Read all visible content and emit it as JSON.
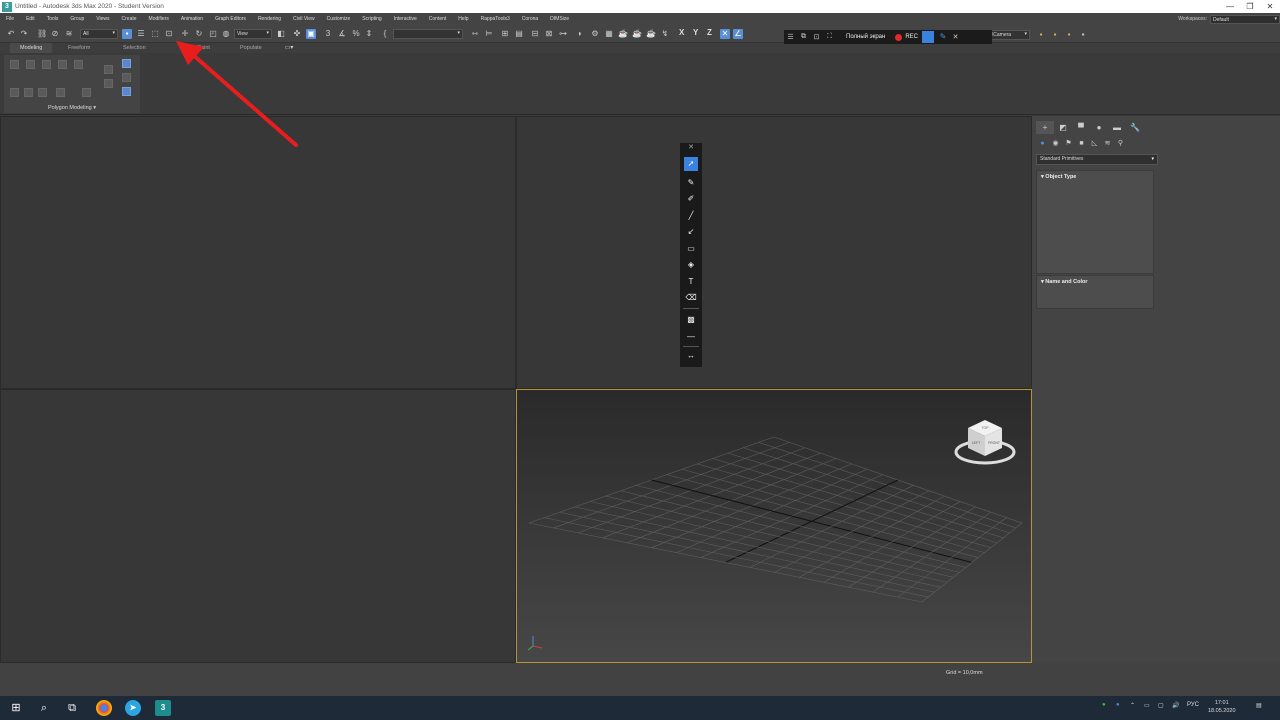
{
  "window": {
    "app_icon": "3ds-max-icon",
    "title": "Untitled - Autodesk 3ds Max 2020 - Student Version",
    "controls": [
      "—",
      "❐",
      "✕"
    ]
  },
  "menubar": {
    "items": [
      "File",
      "Edit",
      "Tools",
      "Group",
      "Views",
      "Create",
      "Modifiers",
      "Animation",
      "Graph Editors",
      "Rendering",
      "Civil View",
      "Customize",
      "Scripting",
      "Interactive",
      "Content",
      "Help",
      "RappaTools3",
      "Corona",
      "DIMSize"
    ],
    "workspaces_label": "Workspaces:",
    "workspaces_value": "Default"
  },
  "toolbar": {
    "filter_value": "All",
    "refcoord_value": "View",
    "named_sel_value": "",
    "axis_x": "X",
    "axis_y": "Y",
    "axis_z": "Z"
  },
  "ribbon": {
    "tabs": [
      "Modeling",
      "Freeform",
      "Selection",
      "Object Paint",
      "Populate"
    ],
    "panel_label": "Polygon Modeling ▾"
  },
  "recorder": {
    "fullscreen_label": "Полный экран",
    "rec_label": "REC",
    "hidden_dropdown": "ts\\Camera"
  },
  "command_panel": {
    "dropdown_value": "Standard Primitives",
    "rollout_object_type": "Object Type",
    "rollout_name_color": "Name and Color"
  },
  "status": {
    "grid_label": "Grid = 10,0mm"
  },
  "viewcube": {
    "top": "TOP",
    "left": "LEFT",
    "front": "FRONT"
  },
  "taskbar": {
    "max_label": "3",
    "lang": "РУС",
    "time": "17:01",
    "date": "18.05.2020"
  },
  "colors": {
    "accent_blue": "#3a82e0",
    "rec_red": "#e02a2a",
    "arrow_red": "#e81e1e",
    "active_viewport_border": "#b6923a"
  }
}
